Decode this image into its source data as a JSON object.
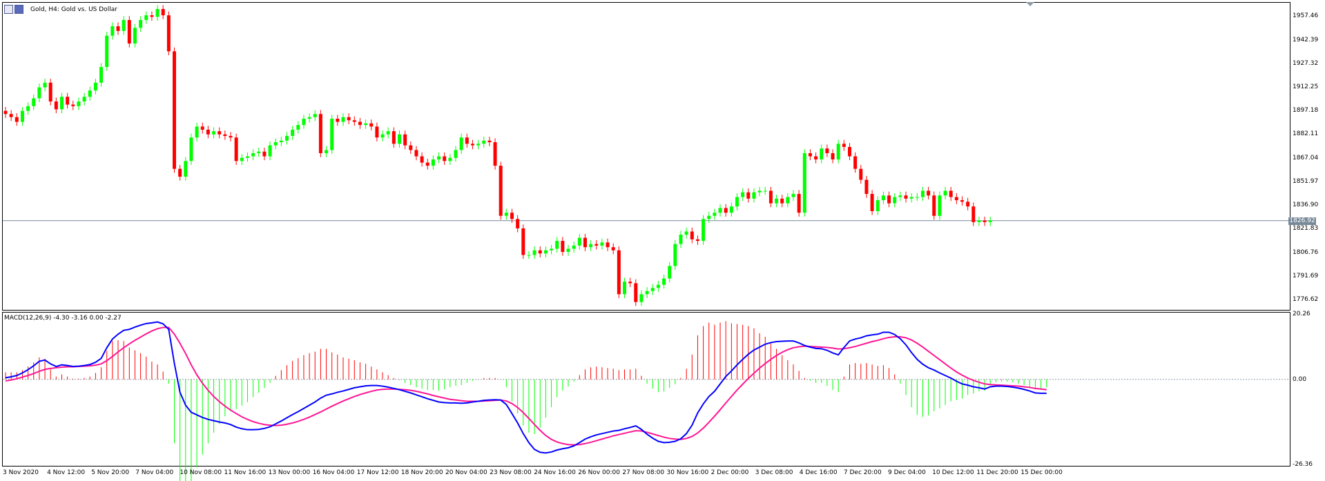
{
  "window": {
    "title": "Gold, H4:  Gold vs. US Dollar"
  },
  "price_axis": {
    "ticks": [
      "1957.46",
      "1942.39",
      "1927.32",
      "1912.25",
      "1897.18",
      "1882.11",
      "1867.04",
      "1851.97",
      "1836.90",
      "1821.83",
      "1806.76",
      "1791.69",
      "1776.62"
    ],
    "current_price": "1826.92"
  },
  "macd": {
    "label": "MACD(12,26,9) -4.30 -3.16 0.00 -2.27",
    "ticks": [
      "20.26",
      "0.00",
      "-26.36"
    ]
  },
  "time_axis": {
    "ticks": [
      "3 Nov 2020",
      "4 Nov 12:00",
      "5 Nov 20:00",
      "7 Nov 04:00",
      "10 Nov 08:00",
      "11 Nov 16:00",
      "13 Nov 00:00",
      "16 Nov 04:00",
      "17 Nov 12:00",
      "18 Nov 20:00",
      "20 Nov 04:00",
      "23 Nov 08:00",
      "24 Nov 16:00",
      "26 Nov 00:00",
      "27 Nov 08:00",
      "30 Nov 16:00",
      "2 Dec 00:00",
      "3 Dec 08:00",
      "4 Dec 16:00",
      "7 Dec 20:00",
      "9 Dec 04:00",
      "10 Dec 12:00",
      "11 Dec 20:00",
      "15 Dec 00:00"
    ]
  },
  "colors": {
    "bull": "#00ff00",
    "bear": "#ff0000",
    "macd_line": "#0000ff",
    "signal_line": "#ff1493",
    "hist_pos": "#ff0000",
    "hist_neg": "#00ff00",
    "price_line": "#778899"
  },
  "chart_data": [
    {
      "type": "candlestick",
      "title": "Gold, H4:  Gold vs. US Dollar",
      "ylim": [
        1770,
        1966
      ],
      "close": [
        1895,
        1893,
        1890,
        1897,
        1900,
        1905,
        1912,
        1915,
        1903,
        1898,
        1906,
        1901,
        1900,
        1903,
        1906,
        1910,
        1915,
        1925,
        1945,
        1951,
        1948,
        1955,
        1940,
        1950,
        1955,
        1958,
        1957,
        1962,
        1958,
        1935,
        1860,
        1855,
        1865,
        1880,
        1887,
        1885,
        1882,
        1884,
        1882,
        1881,
        1880,
        1865,
        1867,
        1868,
        1870,
        1871,
        1868,
        1875,
        1877,
        1878,
        1881,
        1885,
        1888,
        1892,
        1893,
        1895,
        1870,
        1872,
        1892,
        1890,
        1893,
        1891,
        1890,
        1888,
        1889,
        1887,
        1880,
        1882,
        1884,
        1876,
        1882,
        1875,
        1872,
        1868,
        1864,
        1862,
        1866,
        1868,
        1865,
        1867,
        1872,
        1880,
        1876,
        1875,
        1876,
        1878,
        1877,
        1862,
        1830,
        1832,
        1828,
        1822,
        1805,
        1805,
        1808,
        1806,
        1808,
        1809,
        1814,
        1807,
        1809,
        1811,
        1816,
        1810,
        1812,
        1811,
        1813,
        1810,
        1808,
        1780,
        1788,
        1787,
        1775,
        1780,
        1782,
        1784,
        1786,
        1790,
        1798,
        1812,
        1818,
        1820,
        1815,
        1814,
        1828,
        1830,
        1832,
        1835,
        1832,
        1836,
        1842,
        1845,
        1841,
        1845,
        1846,
        1846,
        1838,
        1841,
        1838,
        1842,
        1844,
        1832,
        1870,
        1868,
        1866,
        1873,
        1870,
        1866,
        1876,
        1874,
        1868,
        1860,
        1853,
        1844,
        1833,
        1840,
        1843,
        1838,
        1842,
        1843,
        1841,
        1842,
        1842,
        1846,
        1843,
        1830,
        1843,
        1846,
        1842,
        1840,
        1839,
        1836,
        1826,
        1827,
        1826,
        1827
      ]
    },
    {
      "type": "line",
      "name": "MACD(12,26,9)",
      "ylim": [
        -26.36,
        20.26
      ],
      "macd": [
        0.5,
        0.8,
        1.2,
        2.0,
        3.0,
        4.2,
        5.6,
        6.0,
        4.8,
        4.0,
        4.5,
        4.3,
        4.0,
        4.1,
        4.3,
        4.6,
        5.3,
        6.5,
        9.8,
        12.5,
        14.0,
        15.2,
        15.5,
        16.2,
        16.8,
        17.3,
        17.5,
        17.8,
        17.2,
        15.5,
        5.0,
        -4.0,
        -8.0,
        -10.2,
        -11.0,
        -11.8,
        -12.4,
        -12.8,
        -13.2,
        -13.5,
        -14.0,
        -14.8,
        -15.3,
        -15.6,
        -15.6,
        -15.5,
        -15.2,
        -14.7,
        -13.8,
        -12.9,
        -11.9,
        -10.9,
        -10.0,
        -9.0,
        -8.0,
        -7.0,
        -5.8,
        -4.9,
        -4.5,
        -4.0,
        -3.6,
        -3.1,
        -2.6,
        -2.3,
        -2.0,
        -1.9,
        -1.9,
        -2.1,
        -2.4,
        -2.8,
        -3.2,
        -3.7,
        -4.2,
        -4.8,
        -5.4,
        -6.0,
        -6.5,
        -7.0,
        -7.2,
        -7.3,
        -7.3,
        -7.4,
        -7.3,
        -7.0,
        -6.8,
        -6.5,
        -6.4,
        -6.3,
        -6.4,
        -7.8,
        -10.6,
        -13.5,
        -16.8,
        -19.6,
        -21.7,
        -22.6,
        -22.8,
        -22.5,
        -21.9,
        -21.5,
        -21.2,
        -20.6,
        -19.6,
        -18.5,
        -17.8,
        -17.2,
        -16.8,
        -16.4,
        -16.0,
        -15.8,
        -15.3,
        -14.9,
        -14.4,
        -15.5,
        -17.0,
        -18.2,
        -19.2,
        -19.6,
        -19.5,
        -19.2,
        -18.4,
        -16.8,
        -14.2,
        -10.4,
        -7.6,
        -5.3,
        -3.7,
        -1.4,
        0.9,
        2.6,
        4.5,
        6.2,
        7.8,
        9.1,
        10.0,
        10.9,
        11.4,
        11.7,
        11.8,
        11.9,
        11.9,
        11.3,
        10.5,
        10.0,
        9.6,
        9.5,
        9.0,
        8.2,
        7.6,
        9.9,
        11.9,
        12.5,
        12.9,
        13.5,
        13.8,
        14.0,
        14.6,
        14.6,
        13.9,
        12.6,
        10.7,
        8.3,
        6.2,
        4.7,
        3.6,
        2.9,
        2.0,
        1.2,
        0.4,
        -0.6,
        -1.4,
        -1.8,
        -2.3,
        -2.6,
        -3.0,
        -2.3,
        -2.1,
        -2.1,
        -2.2,
        -2.4,
        -2.7,
        -3.1,
        -3.6,
        -4.2,
        -4.3,
        -4.3
      ],
      "signal": [
        -0.5,
        -0.2,
        0.2,
        0.7,
        1.2,
        1.8,
        2.5,
        3.1,
        3.4,
        3.6,
        3.8,
        3.9,
        3.9,
        4.0,
        4.1,
        4.2,
        4.4,
        4.8,
        5.8,
        7.1,
        8.5,
        9.8,
        11.0,
        12.1,
        13.1,
        14.1,
        15.0,
        15.7,
        16.1,
        16.1,
        14.0,
        11.2,
        8.0,
        4.5,
        1.4,
        -1.2,
        -3.4,
        -5.3,
        -6.9,
        -8.3,
        -9.5,
        -10.6,
        -11.6,
        -12.4,
        -13.1,
        -13.6,
        -14.0,
        -14.2,
        -14.3,
        -14.2,
        -13.9,
        -13.5,
        -13.0,
        -12.4,
        -11.7,
        -10.9,
        -10.1,
        -9.2,
        -8.3,
        -7.5,
        -6.7,
        -6.0,
        -5.3,
        -4.7,
        -4.2,
        -3.7,
        -3.3,
        -3.1,
        -3.0,
        -3.0,
        -3.1,
        -3.2,
        -3.4,
        -3.7,
        -4.1,
        -4.5,
        -5.0,
        -5.4,
        -5.8,
        -6.2,
        -6.4,
        -6.6,
        -6.8,
        -6.8,
        -6.8,
        -6.7,
        -6.6,
        -6.5,
        -6.4,
        -6.7,
        -7.5,
        -8.7,
        -10.3,
        -12.1,
        -14.0,
        -15.8,
        -17.4,
        -18.6,
        -19.4,
        -19.9,
        -20.2,
        -20.3,
        -20.2,
        -19.9,
        -19.5,
        -19.0,
        -18.5,
        -18.0,
        -17.5,
        -17.1,
        -16.7,
        -16.3,
        -15.9,
        -16.0,
        -16.4,
        -16.9,
        -17.4,
        -17.9,
        -18.3,
        -18.5,
        -18.6,
        -18.3,
        -17.7,
        -16.6,
        -15.1,
        -13.3,
        -11.4,
        -9.4,
        -7.3,
        -5.3,
        -3.3,
        -1.5,
        0.3,
        1.9,
        3.5,
        4.9,
        6.2,
        7.4,
        8.4,
        9.2,
        9.8,
        10.1,
        10.3,
        10.2,
        10.1,
        10.0,
        9.9,
        9.7,
        9.4,
        9.5,
        9.8,
        10.2,
        10.7,
        11.2,
        11.7,
        12.1,
        12.6,
        13.0,
        13.2,
        13.2,
        12.9,
        12.2,
        11.2,
        10.0,
        8.7,
        7.4,
        6.1,
        4.8,
        3.5,
        2.3,
        1.3,
        0.4,
        -0.3,
        -0.9,
        -1.4,
        -1.6,
        -1.7,
        -1.8,
        -1.9,
        -2.0,
        -2.1,
        -2.3,
        -2.5,
        -2.8,
        -3.0,
        -3.2
      ]
    }
  ]
}
